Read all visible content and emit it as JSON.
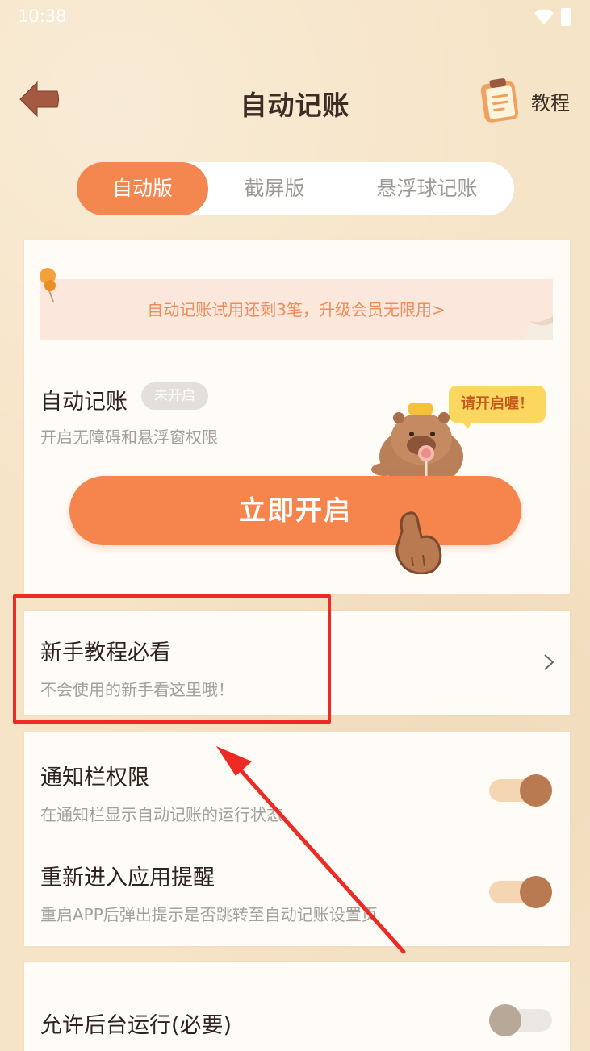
{
  "status_bar": {
    "time": "10:38"
  },
  "header": {
    "title": "自动记账",
    "tutorial_label": "教程"
  },
  "tabs": [
    {
      "label": "自动版",
      "active": true
    },
    {
      "label": "截屏版",
      "active": false
    },
    {
      "label": "悬浮球记账",
      "active": false
    }
  ],
  "main_card": {
    "trial_text": "自动记账试用还剩3笔，升级会员无限用>",
    "title": "自动记账",
    "status_badge": "未开启",
    "description": "开启无障碍和悬浮窗权限",
    "open_button": "立即开启",
    "speech_bubble": "请开启喔！"
  },
  "tutorial_card": {
    "title": "新手教程必看",
    "description": "不会使用的新手看这里哦！"
  },
  "settings": [
    {
      "title": "通知栏权限",
      "description": "在通知栏显示自动记账的运行状态",
      "enabled": true
    },
    {
      "title": "重新进入应用提醒",
      "description": "重启APP后弹出提示是否跳转至自动记账设置页",
      "enabled": true
    }
  ],
  "bottom_setting": {
    "title": "允许后台运行(必要)",
    "enabled": false
  },
  "colors": {
    "accent": "#f4864f",
    "annotation_red": "#ee2a24",
    "toggle_on_knob": "#b97a51",
    "toggle_on_track": "#f4d6b3",
    "toggle_off_knob": "#b8a898",
    "toggle_off_track": "#ece7e1"
  }
}
